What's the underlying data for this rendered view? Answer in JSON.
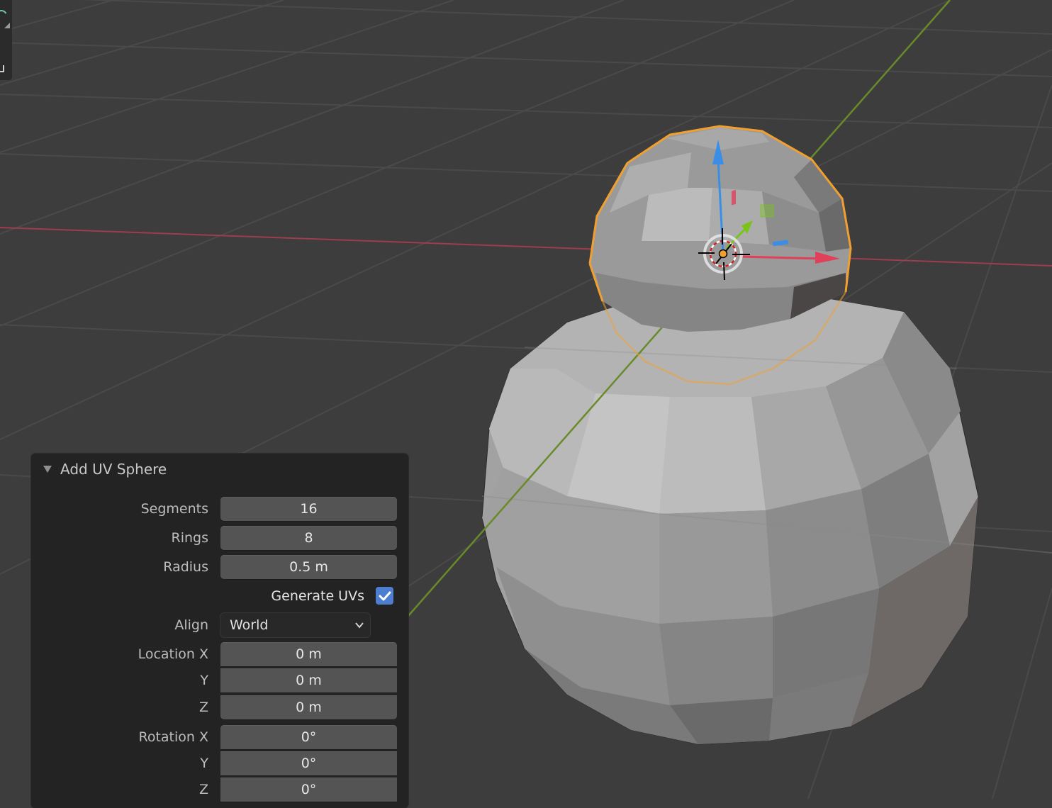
{
  "viewport": {
    "background": "#3d3d3d",
    "grid_color": "#4a4a4a",
    "x_axis_color": "#9c3d50",
    "y_axis_color": "#6a8a2a",
    "selection_outline_color": "#f0a030",
    "gizmo": {
      "x_color": "#e0405a",
      "y_color": "#7ac41a",
      "z_color": "#3a8ee6",
      "origin_color": "#f0a030"
    }
  },
  "operator_panel": {
    "title": "Add UV Sphere",
    "expanded": true,
    "fields": {
      "segments": {
        "label": "Segments",
        "value": "16"
      },
      "rings": {
        "label": "Rings",
        "value": "8"
      },
      "radius": {
        "label": "Radius",
        "value": "0.5 m"
      },
      "generate_uvs": {
        "label": "Generate UVs",
        "checked": true
      },
      "align": {
        "label": "Align",
        "value": "World"
      },
      "location": {
        "label_x": "Location X",
        "label_y": "Y",
        "label_z": "Z",
        "x": "0 m",
        "y": "0 m",
        "z": "0 m"
      },
      "rotation": {
        "label_x": "Rotation X",
        "label_y": "Y",
        "label_z": "Z",
        "x": "0°",
        "y": "0°",
        "z": "0°"
      }
    },
    "checkbox_color": "#4e7ed0"
  }
}
